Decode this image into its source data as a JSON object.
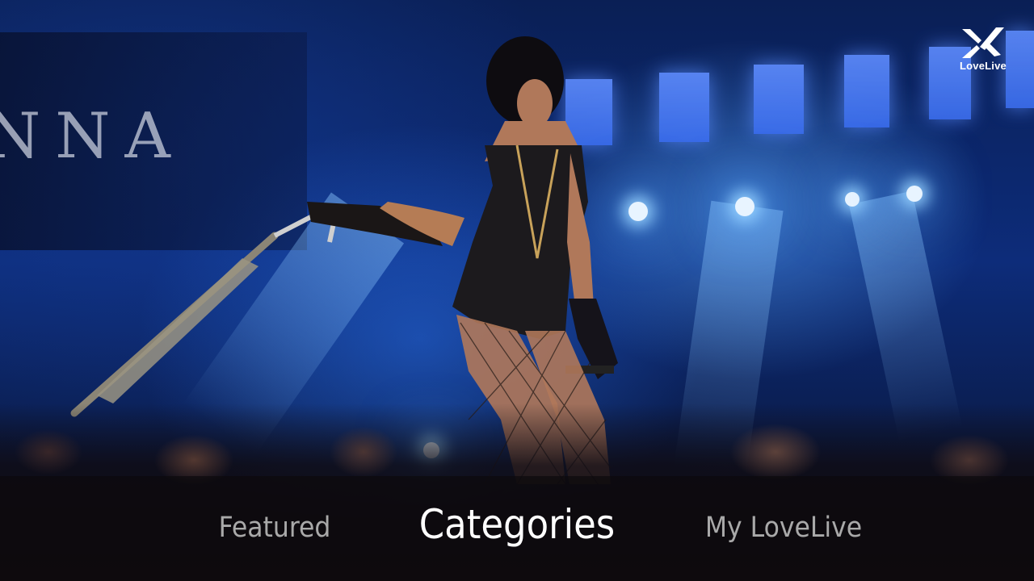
{
  "app": {
    "brand": "LoveLive"
  },
  "background": {
    "banner_text": "NNA"
  },
  "nav": {
    "items": [
      {
        "label": "Featured",
        "active": false
      },
      {
        "label": "Categories",
        "active": true
      },
      {
        "label": "My LoveLive",
        "active": false
      }
    ]
  },
  "icons": {
    "logo": "lovelive-x-logo-icon"
  },
  "colors": {
    "nav_active": "#ffffff",
    "nav_inactive": "#a9a9a9",
    "navbar_bg": "#0c0a0c"
  }
}
